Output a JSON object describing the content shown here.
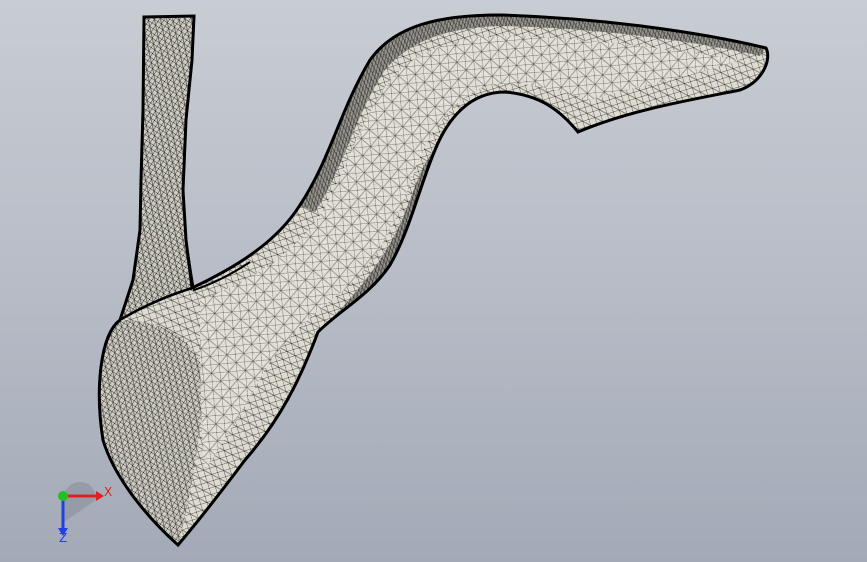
{
  "viewport": {
    "background_top": "#c8ccd3",
    "background_bottom": "#a3aab7"
  },
  "model": {
    "description_icon": "mesh-shoe-heel-model",
    "face_color": "#d9d6cc",
    "edge_color": "#111111",
    "outline_color": "#000000"
  },
  "triad": {
    "x_label": "X",
    "z_label": "Z",
    "x_color": "#e02020",
    "y_color": "#22c022",
    "z_color": "#2040e0"
  }
}
